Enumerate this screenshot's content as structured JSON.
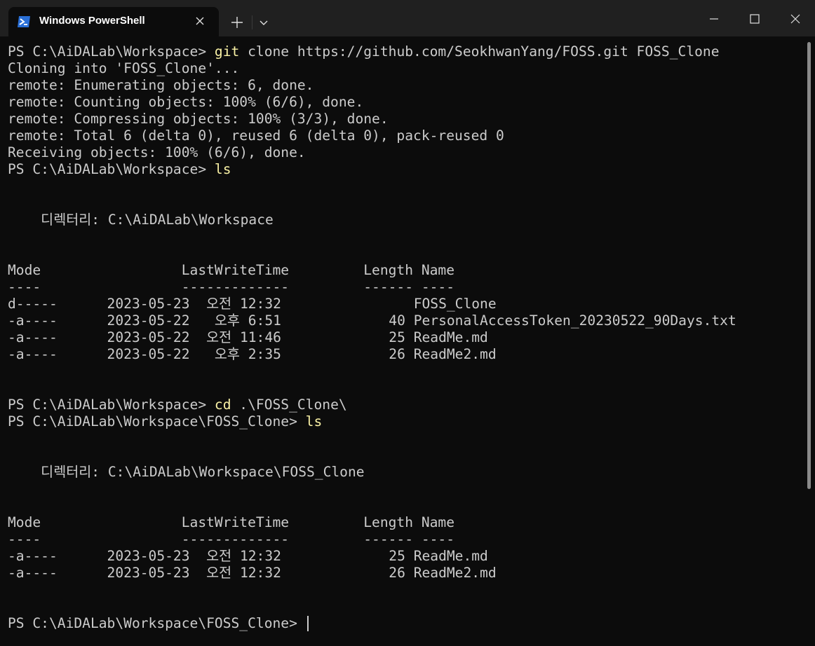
{
  "window": {
    "tab_title": "Windows PowerShell"
  },
  "colors": {
    "background": "#0c0c0c",
    "text": "#cccccc",
    "command": "#f9f1a5",
    "titlebar": "#202020",
    "tab_icon": "#2a6fd6"
  },
  "icons": {
    "tab": "powershell-icon",
    "close_tab": "close-icon",
    "new_tab": "plus-icon",
    "dropdown": "chevron-down-icon",
    "minimize": "minimize-icon",
    "maximize": "maximize-icon",
    "close_window": "close-icon"
  },
  "terminal": {
    "lines": [
      {
        "prompt": "PS C:\\AiDALab\\Workspace> ",
        "cmd": "git",
        "rest": " clone https://github.com/SeokhwanYang/FOSS.git FOSS_Clone"
      },
      {
        "text": "Cloning into 'FOSS_Clone'..."
      },
      {
        "text": "remote: Enumerating objects: 6, done."
      },
      {
        "text": "remote: Counting objects: 100% (6/6), done."
      },
      {
        "text": "remote: Compressing objects: 100% (3/3), done."
      },
      {
        "text": "remote: Total 6 (delta 0), reused 6 (delta 0), pack-reused 0"
      },
      {
        "text": "Receiving objects: 100% (6/6), done."
      },
      {
        "prompt": "PS C:\\AiDALab\\Workspace> ",
        "cmd": "ls",
        "rest": ""
      },
      {
        "text": ""
      },
      {
        "text": ""
      },
      {
        "text": "    디렉터리: C:\\AiDALab\\Workspace"
      },
      {
        "text": ""
      },
      {
        "text": ""
      },
      {
        "text": "Mode                 LastWriteTime         Length Name"
      },
      {
        "text": "----                 -------------         ------ ----"
      },
      {
        "text": "d-----      2023-05-23  오전 12:32                FOSS_Clone"
      },
      {
        "text": "-a----      2023-05-22   오후 6:51             40 PersonalAccessToken_20230522_90Days.txt"
      },
      {
        "text": "-a----      2023-05-22  오전 11:46             25 ReadMe.md"
      },
      {
        "text": "-a----      2023-05-22   오후 2:35             26 ReadMe2.md"
      },
      {
        "text": ""
      },
      {
        "text": ""
      },
      {
        "prompt": "PS C:\\AiDALab\\Workspace> ",
        "cmd": "cd",
        "rest": " .\\FOSS_Clone\\"
      },
      {
        "prompt": "PS C:\\AiDALab\\Workspace\\FOSS_Clone> ",
        "cmd": "ls",
        "rest": ""
      },
      {
        "text": ""
      },
      {
        "text": ""
      },
      {
        "text": "    디렉터리: C:\\AiDALab\\Workspace\\FOSS_Clone"
      },
      {
        "text": ""
      },
      {
        "text": ""
      },
      {
        "text": "Mode                 LastWriteTime         Length Name"
      },
      {
        "text": "----                 -------------         ------ ----"
      },
      {
        "text": "-a----      2023-05-23  오전 12:32             25 ReadMe.md"
      },
      {
        "text": "-a----      2023-05-23  오전 12:32             26 ReadMe2.md"
      },
      {
        "text": ""
      },
      {
        "text": ""
      },
      {
        "prompt": "PS C:\\AiDALab\\Workspace\\FOSS_Clone> ",
        "cmd": "",
        "rest": "",
        "cursor": true
      }
    ]
  }
}
